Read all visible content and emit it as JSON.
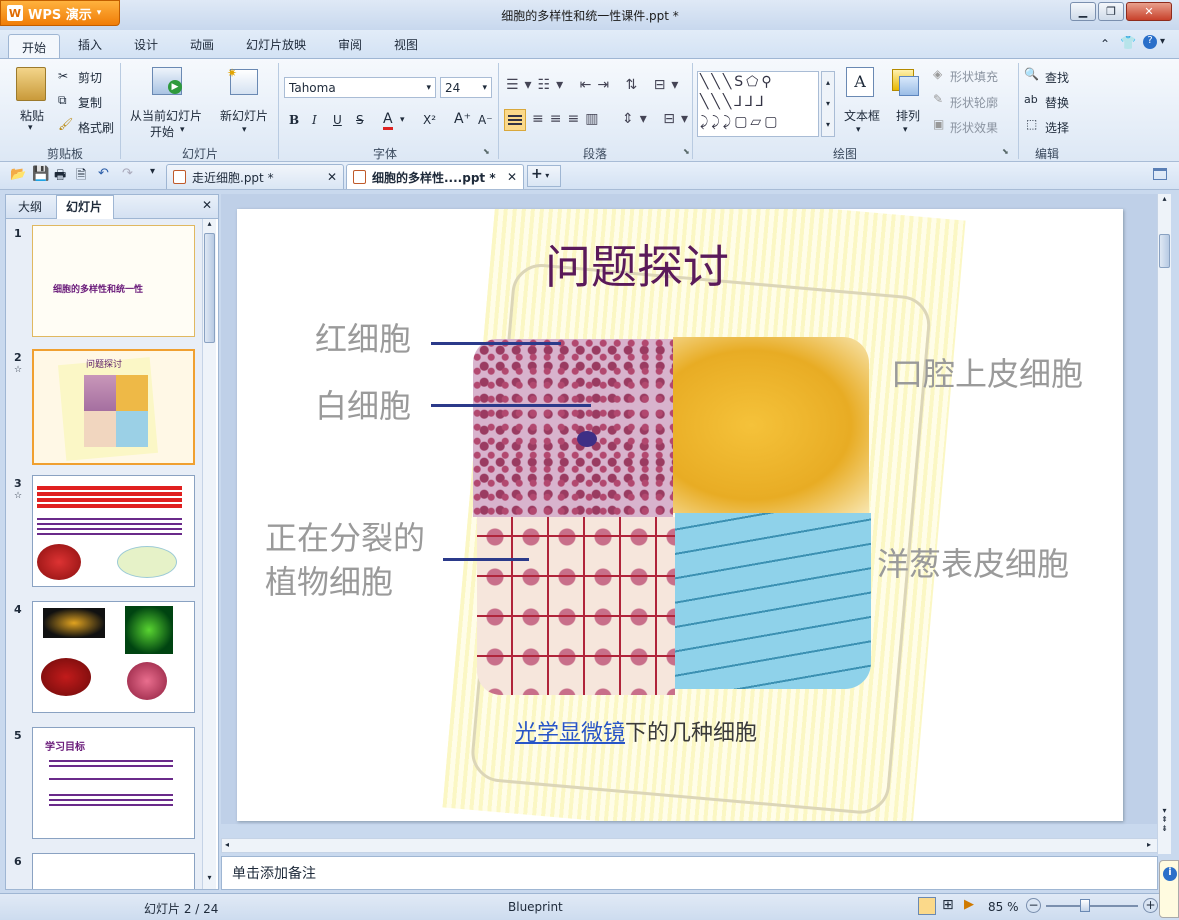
{
  "app": {
    "name": "WPS 演示",
    "window_title": "细胞的多样性和统一性课件.ppt *"
  },
  "menu": {
    "tabs": [
      "开始",
      "插入",
      "设计",
      "动画",
      "幻灯片放映",
      "审阅",
      "视图"
    ]
  },
  "ribbon": {
    "clipboard": {
      "paste": "粘贴",
      "cut": "剪切",
      "copy": "复制",
      "format_painter": "格式刷",
      "group": "剪贴板"
    },
    "slides": {
      "from_current": "从当前幻灯片",
      "start": "开始",
      "new_slide": "新幻灯片",
      "group": "幻灯片"
    },
    "font": {
      "name": "Tahoma",
      "size": "24",
      "bold": "B",
      "italic": "I",
      "underline": "U",
      "strike": "S",
      "color": "A",
      "superscript": "X²",
      "grow": "A⁺",
      "shrink": "A⁻",
      "group": "字体"
    },
    "paragraph": {
      "group": "段落"
    },
    "drawing": {
      "textbox": "文本框",
      "arrange": "排列",
      "fill": "形状填充",
      "outline": "形状轮廓",
      "effect": "形状效果",
      "group": "绘图"
    },
    "edit": {
      "find": "查找",
      "replace": "替换",
      "select": "选择",
      "group": "编辑"
    }
  },
  "doc_tabs": [
    {
      "label": "走近细胞.ppt *"
    },
    {
      "label": "细胞的多样性....ppt *"
    }
  ],
  "left_panel": {
    "tab_outline": "大纲",
    "tab_slides": "幻灯片",
    "slides": [
      {
        "num": "1",
        "title": "细胞的多样性和统一性"
      },
      {
        "num": "2",
        "title": "问题探讨"
      },
      {
        "num": "3",
        "title": ""
      },
      {
        "num": "4",
        "title": ""
      },
      {
        "num": "5",
        "title": "学习目标"
      },
      {
        "num": "6",
        "title": ""
      }
    ]
  },
  "slide": {
    "title": "问题探讨",
    "labels": {
      "red_cell": "红细胞",
      "white_cell": "白细胞",
      "dividing": "正在分裂的",
      "plant_cell": "植物细胞",
      "oral": "口腔上皮细胞",
      "onion": "洋葱表皮细胞"
    },
    "caption_link": "光学显微镜",
    "caption_rest": "下的几种细胞"
  },
  "notes_placeholder": "单击添加备注",
  "status": {
    "slide_pos": "幻灯片 2 / 24",
    "theme": "Blueprint",
    "zoom": "85 %"
  }
}
